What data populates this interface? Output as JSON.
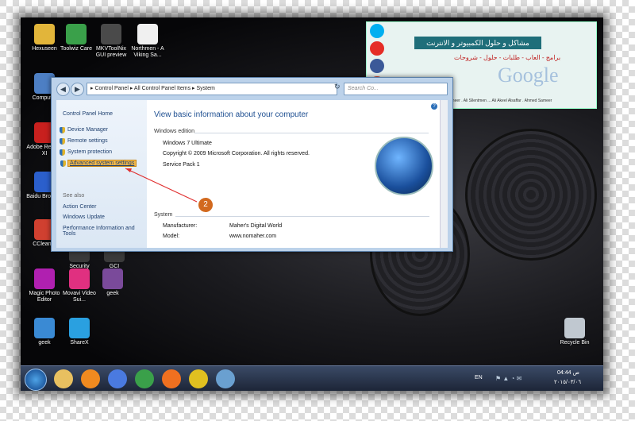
{
  "desktop_icons": [
    {
      "label": "Hexuseen",
      "color": "#e2b53a"
    },
    {
      "label": "Toolwiz Care",
      "color": "#3aa04a"
    },
    {
      "label": "MKVToolNix GUI preview",
      "color": "#4a4a4a"
    },
    {
      "label": "Northmen - A Viking Sa...",
      "color": "#f0f0f0"
    },
    {
      "label": "Computer",
      "color": "#4d7fc4"
    },
    {
      "label": "Adobe Reader XI",
      "color": "#c8201e"
    },
    {
      "label": "Baidu Browser",
      "color": "#2b5fcc"
    },
    {
      "label": "CCleaner",
      "color": "#d04030"
    },
    {
      "label": "Security",
      "color": "#3a3a3a"
    },
    {
      "label": "GCI",
      "color": "#3a3a3a"
    },
    {
      "label": "Magic Photo Editor",
      "color": "#b020b0"
    },
    {
      "label": "Movavi Video Sui...",
      "color": "#e03080"
    },
    {
      "label": "geek",
      "color": "#7a4a9a"
    },
    {
      "label": "geek",
      "color": "#3a8ad4"
    },
    {
      "label": "ShareX",
      "color": "#2aa0e0"
    },
    {
      "label": "Recycle Bin",
      "color": "#c0c8d0"
    }
  ],
  "banner": {
    "line1": "مشاكل و حلول الكمبيوتر و الانترنت",
    "line2": "برامج - العاب - طلبات - حلول - شروحات",
    "google": "Google",
    "names": "Husam Mohammed . Ali Qusay Sameer . Ali Sllentmen ... Ali Akeel Alsaffar . Ahmed Sameer",
    "social": [
      {
        "name": "skype-icon",
        "color": "#00aff0"
      },
      {
        "name": "youtube-icon",
        "color": "#e52d27"
      },
      {
        "name": "facebook-icon",
        "color": "#3b5998"
      },
      {
        "name": "google-plus-icon",
        "color": "#dd4b39"
      },
      {
        "name": "twitter-icon",
        "color": "#55acee"
      }
    ]
  },
  "window": {
    "address": "▸ Control Panel ▸ All Control Panel Items ▸ System",
    "search_placeholder": "Search Co...",
    "left_nav": {
      "home": "Control Panel Home",
      "links": [
        "Device Manager",
        "Remote settings",
        "System protection",
        "Advanced system settings"
      ],
      "see_also_label": "See also",
      "see_also": [
        "Action Center",
        "Windows Update",
        "Performance Information and Tools"
      ]
    },
    "heading": "View basic information about your computer",
    "edition_label": "Windows edition",
    "edition": "Windows 7 Ultimate",
    "copyright": "Copyright © 2009 Microsoft Corporation. All rights reserved.",
    "service_pack": "Service Pack 1",
    "system_label": "System",
    "manufacturer_label": "Manufacturer:",
    "manufacturer": "Maher's Digital World",
    "model_label": "Model:",
    "model": "www.nomaher.com"
  },
  "annotation": {
    "step": "2"
  },
  "taskbar": {
    "items": [
      "libraries-icon",
      "media-player-icon",
      "baidu-icon",
      "chrome-icon",
      "firefox-icon",
      "chrome-canary-icon",
      "network-icon"
    ],
    "lang": "EN",
    "time": "04:44 ص",
    "date": "٢٠١٥/٠٣/٠٦"
  }
}
